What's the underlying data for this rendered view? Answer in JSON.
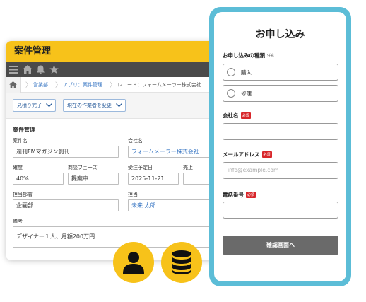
{
  "window": {
    "title": "案件管理",
    "breadcrumb": [
      "営業部",
      "アプリ：案件管理",
      "レコード：フォームメーラー株式会社"
    ],
    "actions": [
      "見積り完了",
      "現在の作業者を変更"
    ],
    "section_title": "案件管理",
    "fields": {
      "case_name": {
        "label": "案件名",
        "value": "週刊FMマガジン創刊"
      },
      "company": {
        "label": "会社名",
        "value": "フォームメーラー株式会社"
      },
      "probability": {
        "label": "確度",
        "value": "40%"
      },
      "phase": {
        "label": "商談フェーズ",
        "value": "提案中"
      },
      "order_date": {
        "label": "受注予定日",
        "value": "2025-11-21"
      },
      "sales": {
        "label": "売上",
        "value": "¥"
      },
      "department": {
        "label": "担当部署",
        "value": "企画部"
      },
      "assignee": {
        "label": "担当",
        "value": "未来 太郎"
      },
      "notes": {
        "label": "備考",
        "value": "デザイナー１人、月額200万円"
      }
    }
  },
  "form": {
    "title": "お申し込み",
    "type_label": "お申し込みの種類",
    "optional_tag": "任意",
    "required_tag": "必須",
    "options": [
      "購入",
      "修理"
    ],
    "company_label": "会社名",
    "email_label": "メールアドレス",
    "email_placeholder": "info@example.com",
    "phone_label": "電話番号",
    "submit_label": "確認画面へ"
  },
  "colors": {
    "accent_yellow": "#f7c21a",
    "card_border": "#5cbdd7",
    "toolbar": "#4a4a4a",
    "required_red": "#d8262a",
    "link_blue": "#3b78c4"
  },
  "icons": [
    "menu-icon",
    "home-icon",
    "bell-icon",
    "star-icon",
    "chevron-down-icon",
    "user-icon",
    "database-icon"
  ]
}
